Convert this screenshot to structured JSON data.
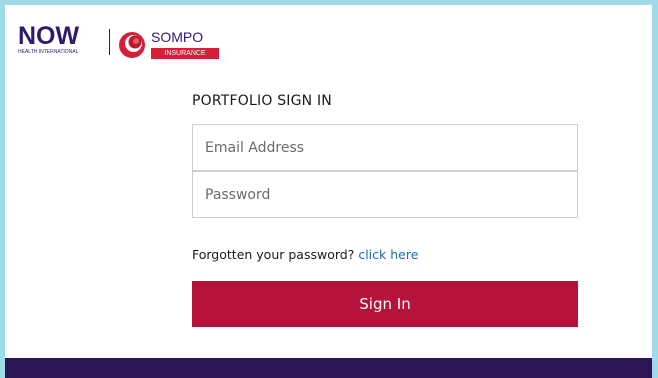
{
  "brand": {
    "now_word": "NOW",
    "now_tagline": "HEALTH INTERNATIONAL",
    "sompo_word": "SOMPO",
    "sompo_badge": "INSURANCE"
  },
  "login": {
    "title": "PORTFOLIO SIGN IN",
    "email_placeholder": "Email Address",
    "email_value": "",
    "password_placeholder": "Password",
    "password_value": "",
    "forgot_text": "Forgotten your password?",
    "forgot_link": "click here",
    "signin_label": "Sign In"
  },
  "colors": {
    "page_border": "#9fd9ea",
    "brand_navy": "#2e1b6e",
    "sompo_red": "#d5203a",
    "button": "#b5133a",
    "link": "#1a6cb4",
    "footer": "#2d1656"
  }
}
